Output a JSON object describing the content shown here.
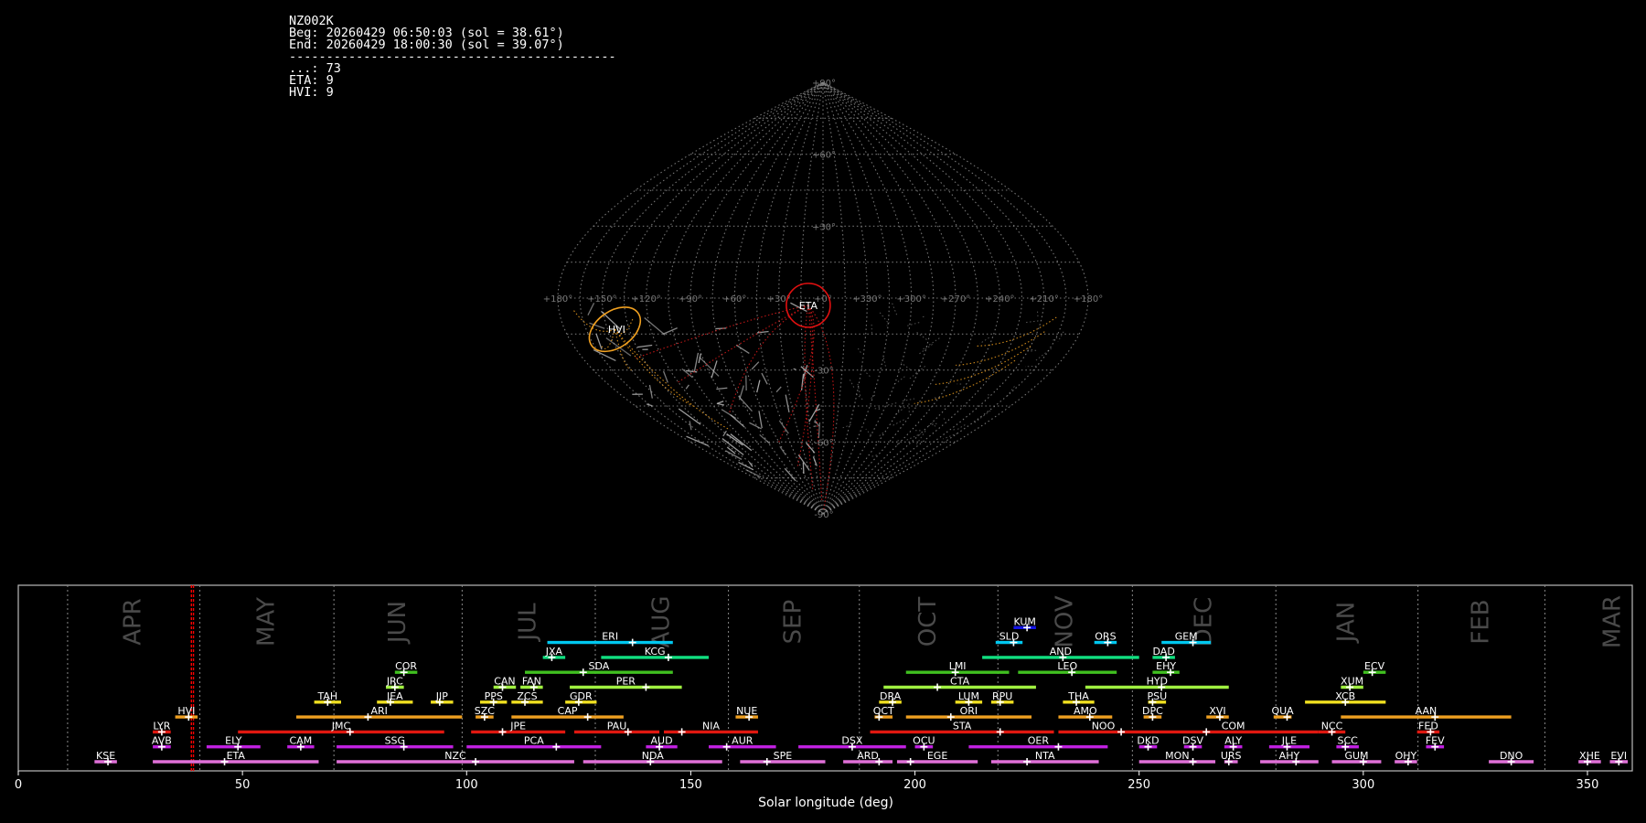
{
  "info": {
    "camera": "NZ002K",
    "beg": "Beg: 20260429 06:50:03 (sol = 38.61°)",
    "end": "End: 20260429 18:00:30 (sol = 39.07°)",
    "rule": "--------------------------------------------",
    "counts": [
      "...: 73",
      "ETA: 9",
      "HVI: 9"
    ]
  },
  "sky_chart": {
    "projection": "sinusoidal",
    "lon_labels": [
      "+180°",
      "+150°",
      "+120°",
      "+90°",
      "+60°",
      "+30°",
      "+0°",
      "+330°",
      "+300°",
      "+270°",
      "+240°",
      "+210°",
      "+180°"
    ],
    "lat_labels": [
      "+90°",
      "+60°",
      "+30°",
      "-30°",
      "-60°",
      "-90°"
    ],
    "showers": [
      {
        "code": "ETA",
        "lon_offset": -10,
        "lat": -3,
        "color": "#e01010"
      },
      {
        "code": "HVI",
        "lon_offset": -145,
        "lat": -13,
        "color": "#f0a020"
      }
    ],
    "colors": {
      "sporadic": "#b8b8b8",
      "eta": "#d01818",
      "hvi": "#f0a020",
      "grid": "#8a8a8a"
    }
  },
  "chart_data": {
    "type": "timeline",
    "xlabel": "Solar longitude (deg)",
    "xlim": [
      0,
      360
    ],
    "xticks": [
      0,
      50,
      100,
      150,
      200,
      250,
      300,
      350
    ],
    "current_sol": [
      38.61,
      39.07
    ],
    "months": [
      {
        "name": "APR",
        "start": 11.0,
        "end": 40.5
      },
      {
        "name": "MAY",
        "start": 40.5,
        "end": 70.4
      },
      {
        "name": "JUN",
        "start": 70.4,
        "end": 99.0
      },
      {
        "name": "JUL",
        "start": 99.0,
        "end": 128.7
      },
      {
        "name": "AUG",
        "start": 128.7,
        "end": 158.4
      },
      {
        "name": "SEP",
        "start": 158.4,
        "end": 187.6
      },
      {
        "name": "OCT",
        "start": 187.6,
        "end": 218.5
      },
      {
        "name": "NOV",
        "start": 218.5,
        "end": 248.5
      },
      {
        "name": "DEC",
        "start": 248.5,
        "end": 280.5
      },
      {
        "name": "JAN",
        "start": 280.5,
        "end": 312.2
      },
      {
        "name": "FEB",
        "start": 312.2,
        "end": 340.5
      },
      {
        "name": "MAR",
        "start": 340.5,
        "end": 371.0
      }
    ],
    "showers": [
      {
        "code": "KUM",
        "s": 222,
        "e": 227,
        "p": 225,
        "row": 9,
        "color": "#1414e6"
      },
      {
        "code": "ERI",
        "s": 118,
        "e": 146,
        "p": 137,
        "row": 8,
        "color": "#00c8f0"
      },
      {
        "code": "SLD",
        "s": 218,
        "e": 224,
        "p": 222,
        "row": 8,
        "color": "#00c8f0"
      },
      {
        "code": "ORS",
        "s": 240,
        "e": 245,
        "p": 243,
        "row": 8,
        "color": "#00c8f0"
      },
      {
        "code": "GEM",
        "s": 255,
        "e": 266,
        "p": 262,
        "row": 8,
        "color": "#00c8f0"
      },
      {
        "code": "JXA",
        "s": 117,
        "e": 122,
        "p": 119,
        "row": 7,
        "color": "#10e080"
      },
      {
        "code": "KCG",
        "s": 130,
        "e": 154,
        "p": 145,
        "row": 7,
        "color": "#10e080"
      },
      {
        "code": "AND",
        "s": 215,
        "e": 250,
        "p": 233,
        "row": 7,
        "color": "#10e080"
      },
      {
        "code": "DAD",
        "s": 253,
        "e": 258,
        "p": 256,
        "row": 7,
        "color": "#10e080"
      },
      {
        "code": "COR",
        "s": 84,
        "e": 89,
        "p": 86,
        "row": 6,
        "color": "#40c020"
      },
      {
        "code": "SDA",
        "s": 113,
        "e": 146,
        "p": 126,
        "row": 6,
        "color": "#40c020"
      },
      {
        "code": "LMI",
        "s": 198,
        "e": 221,
        "p": 209,
        "row": 6,
        "color": "#40c020"
      },
      {
        "code": "LEO",
        "s": 223,
        "e": 245,
        "p": 235,
        "row": 6,
        "color": "#40c020"
      },
      {
        "code": "EHY",
        "s": 253,
        "e": 259,
        "p": 257,
        "row": 6,
        "color": "#40c020"
      },
      {
        "code": "ECV",
        "s": 300,
        "e": 305,
        "p": 302,
        "row": 6,
        "color": "#40c020"
      },
      {
        "code": "JRC",
        "s": 82,
        "e": 86,
        "p": 84,
        "row": 5,
        "color": "#a0f040"
      },
      {
        "code": "CAN",
        "s": 106,
        "e": 111,
        "p": 108,
        "row": 5,
        "color": "#a0f040"
      },
      {
        "code": "FAN",
        "s": 112,
        "e": 117,
        "p": 115,
        "row": 5,
        "color": "#a0f040"
      },
      {
        "code": "PER",
        "s": 123,
        "e": 148,
        "p": 140,
        "row": 5,
        "color": "#a0f040"
      },
      {
        "code": "CTA",
        "s": 193,
        "e": 227,
        "p": 205,
        "row": 5,
        "color": "#a0f040"
      },
      {
        "code": "HYD",
        "s": 238,
        "e": 270,
        "p": 255,
        "row": 5,
        "color": "#a0f040"
      },
      {
        "code": "XUM",
        "s": 295,
        "e": 300,
        "p": 297,
        "row": 5,
        "color": "#a0f040"
      },
      {
        "code": "TAH",
        "s": 66,
        "e": 72,
        "p": 69,
        "row": 4,
        "color": "#f0e020"
      },
      {
        "code": "JEA",
        "s": 80,
        "e": 88,
        "p": 83,
        "row": 4,
        "color": "#f0e020"
      },
      {
        "code": "JIP",
        "s": 92,
        "e": 97,
        "p": 94,
        "row": 4,
        "color": "#f0e020"
      },
      {
        "code": "PPS",
        "s": 103,
        "e": 109,
        "p": 106,
        "row": 4,
        "color": "#f0e020"
      },
      {
        "code": "ZCS",
        "s": 110,
        "e": 117,
        "p": 113,
        "row": 4,
        "color": "#f0e020"
      },
      {
        "code": "GDR",
        "s": 122,
        "e": 129,
        "p": 125,
        "row": 4,
        "color": "#f0e020"
      },
      {
        "code": "DRA",
        "s": 192,
        "e": 197,
        "p": 195,
        "row": 4,
        "color": "#f0e020"
      },
      {
        "code": "LUM",
        "s": 209,
        "e": 215,
        "p": 212,
        "row": 4,
        "color": "#f0e020"
      },
      {
        "code": "RPU",
        "s": 217,
        "e": 222,
        "p": 219,
        "row": 4,
        "color": "#f0e020"
      },
      {
        "code": "THA",
        "s": 233,
        "e": 240,
        "p": 236,
        "row": 4,
        "color": "#f0e020"
      },
      {
        "code": "PSU",
        "s": 252,
        "e": 256,
        "p": 253,
        "row": 4,
        "color": "#f0e020"
      },
      {
        "code": "XCB",
        "s": 287,
        "e": 305,
        "p": 296,
        "row": 4,
        "color": "#f0e020"
      },
      {
        "code": "HVI",
        "s": 35,
        "e": 40,
        "p": 38,
        "row": 3,
        "color": "#f0a020"
      },
      {
        "code": "ARI",
        "s": 62,
        "e": 99,
        "p": 78,
        "row": 3,
        "color": "#f0a020"
      },
      {
        "code": "SZC",
        "s": 102,
        "e": 106,
        "p": 104,
        "row": 3,
        "color": "#f0a020"
      },
      {
        "code": "CAP",
        "s": 110,
        "e": 135,
        "p": 127,
        "row": 3,
        "color": "#f0a020"
      },
      {
        "code": "NUE",
        "s": 160,
        "e": 165,
        "p": 163,
        "row": 3,
        "color": "#f0a020"
      },
      {
        "code": "OCT",
        "s": 191,
        "e": 195,
        "p": 192,
        "row": 3,
        "color": "#f0a020"
      },
      {
        "code": "ORI",
        "s": 198,
        "e": 226,
        "p": 208,
        "row": 3,
        "color": "#f0a020"
      },
      {
        "code": "AMO",
        "s": 232,
        "e": 244,
        "p": 239,
        "row": 3,
        "color": "#f0a020"
      },
      {
        "code": "DPC",
        "s": 251,
        "e": 255,
        "p": 253,
        "row": 3,
        "color": "#f0a020"
      },
      {
        "code": "XVI",
        "s": 265,
        "e": 270,
        "p": 268,
        "row": 3,
        "color": "#f0a020"
      },
      {
        "code": "QUA",
        "s": 280,
        "e": 284,
        "p": 283,
        "row": 3,
        "color": "#f0a020"
      },
      {
        "code": "AAN",
        "s": 295,
        "e": 333,
        "p": 316,
        "row": 3,
        "color": "#f0a020"
      },
      {
        "code": "LYR",
        "s": 30,
        "e": 34,
        "p": 32,
        "row": 2,
        "color": "#e01810"
      },
      {
        "code": "JMC",
        "s": 49,
        "e": 95,
        "p": 74,
        "row": 2,
        "color": "#e01810"
      },
      {
        "code": "JPE",
        "s": 101,
        "e": 122,
        "p": 108,
        "row": 2,
        "color": "#e01810"
      },
      {
        "code": "PAU",
        "s": 124,
        "e": 143,
        "p": 136,
        "row": 2,
        "color": "#e01810"
      },
      {
        "code": "NIA",
        "s": 144,
        "e": 165,
        "p": 148,
        "row": 2,
        "color": "#e01810"
      },
      {
        "code": "STA",
        "s": 190,
        "e": 231,
        "p": 219,
        "row": 2,
        "color": "#e01810"
      },
      {
        "code": "NOO",
        "s": 232,
        "e": 252,
        "p": 246,
        "row": 2,
        "color": "#e01810"
      },
      {
        "code": "COM",
        "s": 252,
        "e": 290,
        "p": 265,
        "row": 2,
        "color": "#e01810"
      },
      {
        "code": "NCC",
        "s": 290,
        "e": 296,
        "p": 293,
        "row": 2,
        "color": "#e01810"
      },
      {
        "code": "FED",
        "s": 312,
        "e": 317,
        "p": 315,
        "row": 2,
        "color": "#e01810"
      },
      {
        "code": "AVB",
        "s": 30,
        "e": 34,
        "p": 32,
        "row": 1,
        "color": "#c020e0"
      },
      {
        "code": "ELY",
        "s": 42,
        "e": 54,
        "p": 49,
        "row": 1,
        "color": "#c020e0"
      },
      {
        "code": "CAM",
        "s": 60,
        "e": 66,
        "p": 63,
        "row": 1,
        "color": "#c020e0"
      },
      {
        "code": "SSG",
        "s": 71,
        "e": 97,
        "p": 86,
        "row": 1,
        "color": "#c020e0"
      },
      {
        "code": "PCA",
        "s": 100,
        "e": 130,
        "p": 120,
        "row": 1,
        "color": "#c020e0"
      },
      {
        "code": "AUD",
        "s": 140,
        "e": 147,
        "p": 143,
        "row": 1,
        "color": "#c020e0"
      },
      {
        "code": "AUR",
        "s": 154,
        "e": 169,
        "p": 158,
        "row": 1,
        "color": "#c020e0"
      },
      {
        "code": "DSX",
        "s": 174,
        "e": 198,
        "p": 186,
        "row": 1,
        "color": "#c020e0"
      },
      {
        "code": "OCU",
        "s": 200,
        "e": 204,
        "p": 202,
        "row": 1,
        "color": "#c020e0"
      },
      {
        "code": "OER",
        "s": 212,
        "e": 243,
        "p": 232,
        "row": 1,
        "color": "#c020e0"
      },
      {
        "code": "DKD",
        "s": 250,
        "e": 254,
        "p": 252,
        "row": 1,
        "color": "#c020e0"
      },
      {
        "code": "DSV",
        "s": 260,
        "e": 264,
        "p": 262,
        "row": 1,
        "color": "#c020e0"
      },
      {
        "code": "ALY",
        "s": 269,
        "e": 273,
        "p": 271,
        "row": 1,
        "color": "#c020e0"
      },
      {
        "code": "JLE",
        "s": 279,
        "e": 288,
        "p": 283,
        "row": 1,
        "color": "#c020e0"
      },
      {
        "code": "SCC",
        "s": 294,
        "e": 299,
        "p": 296,
        "row": 1,
        "color": "#c020e0"
      },
      {
        "code": "FEV",
        "s": 314,
        "e": 318,
        "p": 316,
        "row": 1,
        "color": "#c020e0"
      },
      {
        "code": "KSE",
        "s": 17,
        "e": 22,
        "p": 20,
        "row": 0,
        "color": "#e070d8"
      },
      {
        "code": "ETA",
        "s": 30,
        "e": 67,
        "p": 46,
        "row": 0,
        "color": "#e070d8"
      },
      {
        "code": "NZC",
        "s": 71,
        "e": 124,
        "p": 102,
        "row": 0,
        "color": "#e070d8"
      },
      {
        "code": "NDA",
        "s": 126,
        "e": 157,
        "p": 141,
        "row": 0,
        "color": "#e070d8"
      },
      {
        "code": "SPE",
        "s": 161,
        "e": 180,
        "p": 167,
        "row": 0,
        "color": "#e070d8"
      },
      {
        "code": "ARD",
        "s": 184,
        "e": 195,
        "p": 192,
        "row": 0,
        "color": "#e070d8"
      },
      {
        "code": "EGE",
        "s": 196,
        "e": 214,
        "p": 199,
        "row": 0,
        "color": "#e070d8"
      },
      {
        "code": "NTA",
        "s": 217,
        "e": 241,
        "p": 225,
        "row": 0,
        "color": "#e070d8"
      },
      {
        "code": "MON",
        "s": 250,
        "e": 267,
        "p": 262,
        "row": 0,
        "color": "#e070d8"
      },
      {
        "code": "URS",
        "s": 269,
        "e": 272,
        "p": 270,
        "row": 0,
        "color": "#e070d8"
      },
      {
        "code": "AHY",
        "s": 277,
        "e": 290,
        "p": 285,
        "row": 0,
        "color": "#e070d8"
      },
      {
        "code": "GUM",
        "s": 293,
        "e": 304,
        "p": 300,
        "row": 0,
        "color": "#e070d8"
      },
      {
        "code": "OHY",
        "s": 307,
        "e": 312,
        "p": 310,
        "row": 0,
        "color": "#e070d8"
      },
      {
        "code": "DNO",
        "s": 328,
        "e": 338,
        "p": 333,
        "row": 0,
        "color": "#e070d8"
      },
      {
        "code": "XHE",
        "s": 348,
        "e": 353,
        "p": 350,
        "row": 0,
        "color": "#e070d8"
      },
      {
        "code": "EVI",
        "s": 355,
        "e": 359,
        "p": 357,
        "row": 0,
        "color": "#e070d8"
      }
    ]
  }
}
